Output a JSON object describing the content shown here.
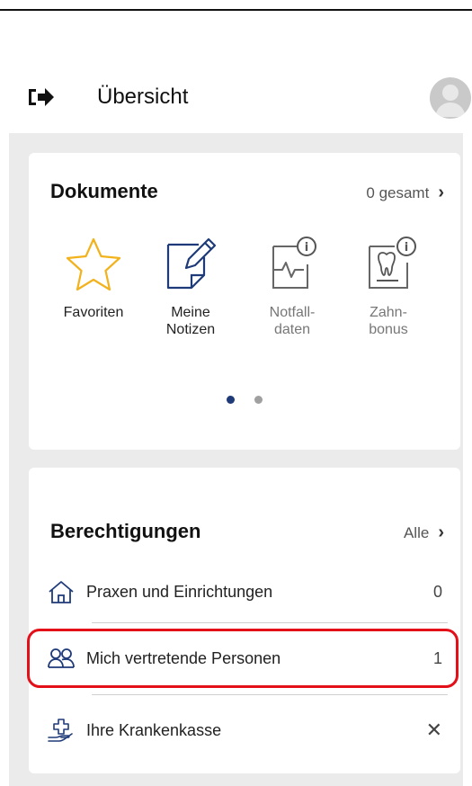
{
  "header": {
    "title": "Übersicht"
  },
  "documents": {
    "title": "Dokumente",
    "total_link": "0 gesamt",
    "items": [
      {
        "label_line1": "Favoriten",
        "label_line2": "",
        "icon": "star-icon"
      },
      {
        "label_line1": "Meine",
        "label_line2": "Notizen",
        "icon": "notes-icon"
      },
      {
        "label_line1": "Notfall-",
        "label_line2": "daten",
        "icon": "emergency-data-icon"
      },
      {
        "label_line1": "Zahn-",
        "label_line2": "bonus",
        "icon": "tooth-icon"
      }
    ],
    "pagination": {
      "pages": 2,
      "active": 1
    }
  },
  "permissions": {
    "title": "Berechtigungen",
    "all_link": "Alle",
    "rows": [
      {
        "label": "Praxen und Einrichtungen",
        "value": "0",
        "icon": "house-icon"
      },
      {
        "label": "Mich vertretende Personen",
        "value": "1",
        "icon": "people-icon"
      },
      {
        "label": "Ihre Krankenkasse",
        "value": "✕",
        "icon": "insurance-hand-icon"
      }
    ]
  },
  "colors": {
    "accent": "#1e3a78",
    "star": "#f2b21c",
    "highlight": "#e3101a",
    "background": "#ebebeb"
  }
}
